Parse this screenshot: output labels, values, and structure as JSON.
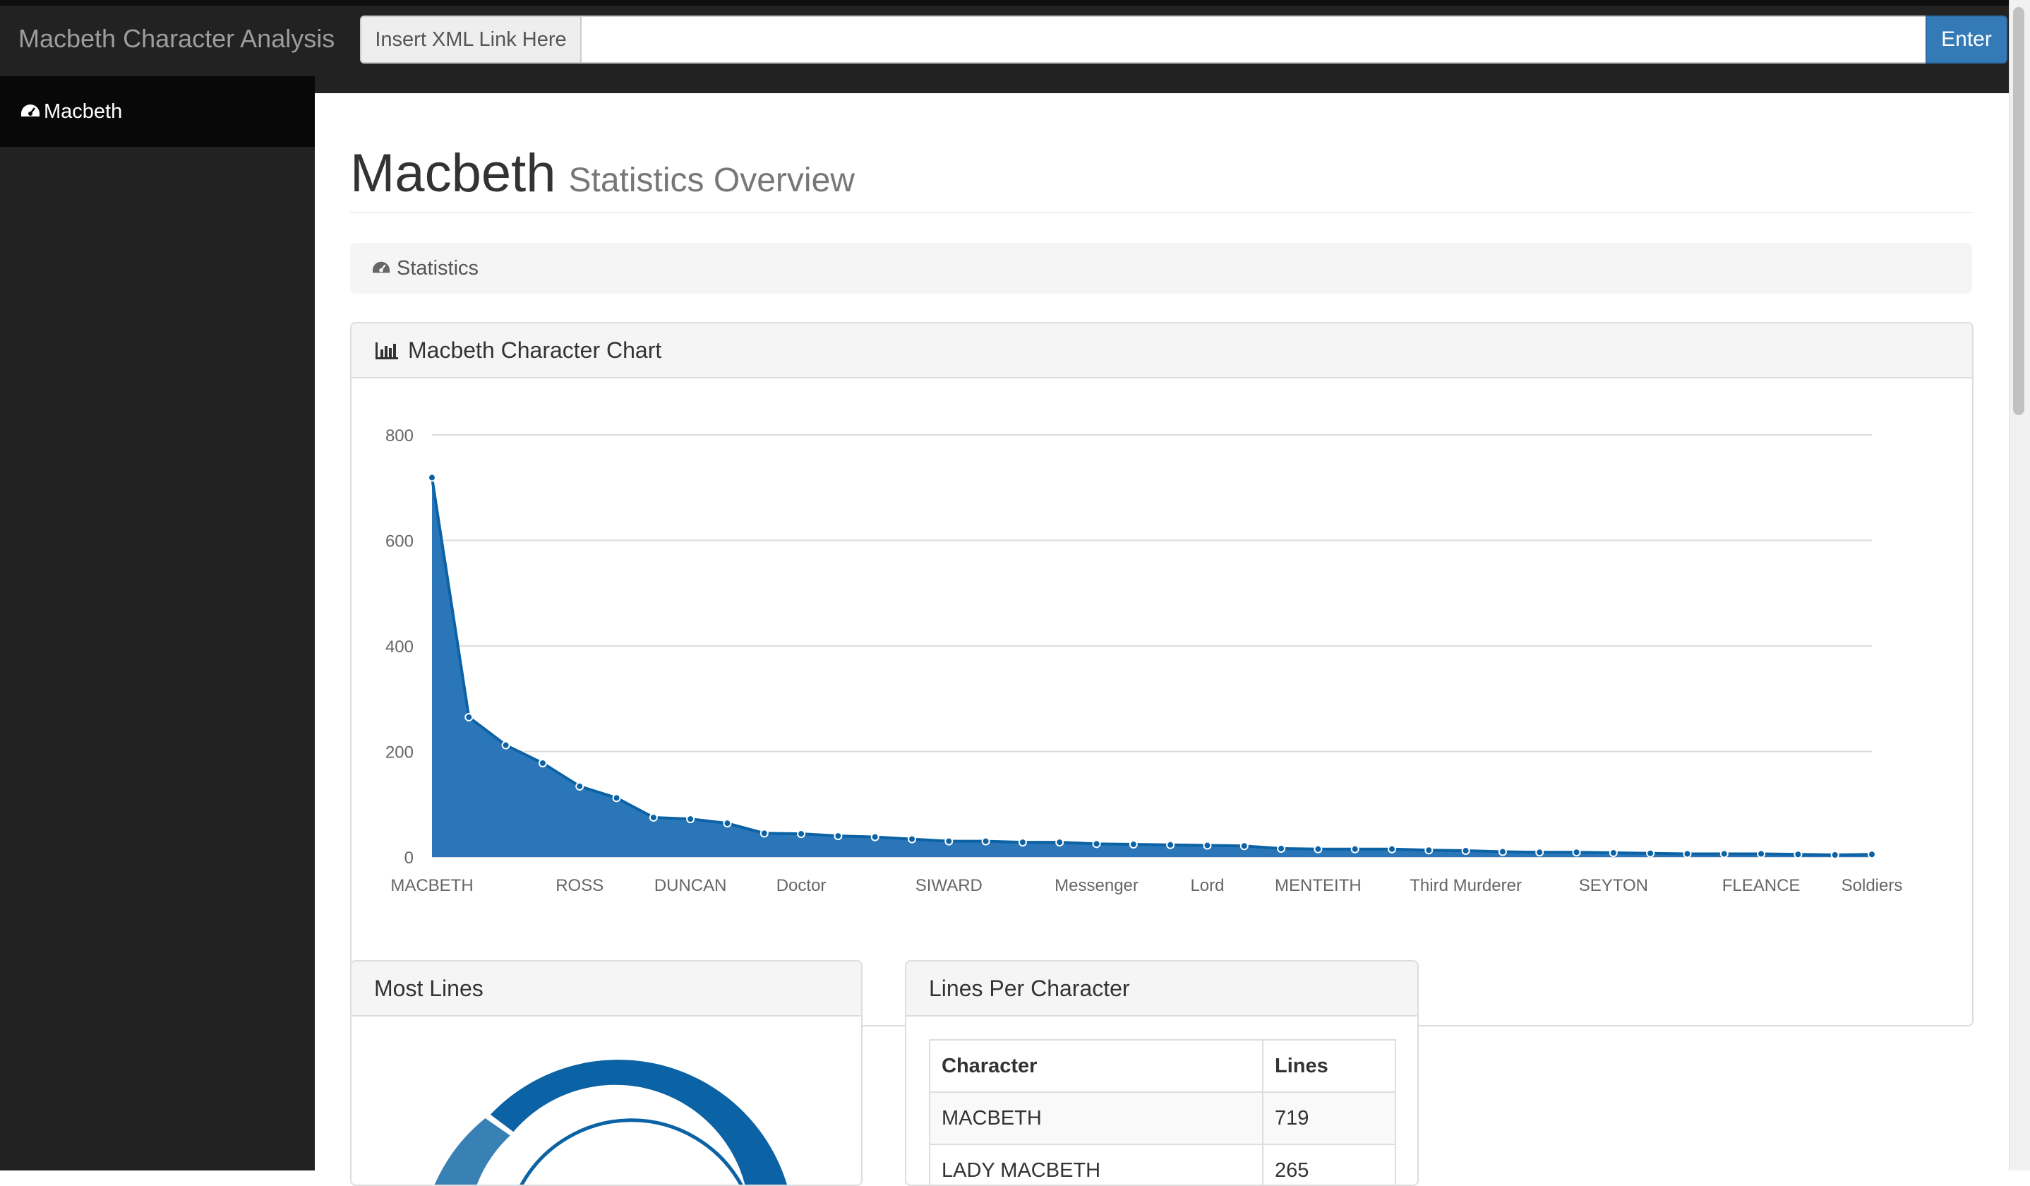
{
  "navbar": {
    "brand": "Macbeth Character Analysis",
    "xml_label": "Insert XML Link Here",
    "xml_value": "",
    "enter_label": "Enter"
  },
  "sidebar": {
    "items": [
      {
        "label": "Macbeth",
        "icon": "dashboard-icon"
      }
    ]
  },
  "header": {
    "title": "Macbeth",
    "subtitle": "Statistics Overview"
  },
  "breadcrumb": {
    "label": "Statistics",
    "icon": "dashboard-icon"
  },
  "chart_panel": {
    "title": "Macbeth Character Chart",
    "icon": "bar-chart-icon"
  },
  "chart_data": {
    "type": "area",
    "title": "",
    "xlabel": "",
    "ylabel": "",
    "ylim": [
      0,
      800
    ],
    "yticks": [
      0,
      200,
      400,
      600,
      800
    ],
    "grid": true,
    "color": "#1f6fb5",
    "x_tick_labels": [
      "MACBETH",
      "ROSS",
      "DUNCAN",
      "Doctor",
      "SIWARD",
      "Messenger",
      "Lord",
      "MENTEITH",
      "Third Murderer",
      "SEYTON",
      "FLEANCE",
      "Soldiers"
    ],
    "x_tick_positions": [
      0,
      4,
      7,
      10,
      14,
      18,
      21,
      24,
      28,
      32,
      36,
      39
    ],
    "values": [
      719,
      265,
      212,
      178,
      134,
      112,
      75,
      72,
      64,
      45,
      44,
      40,
      38,
      34,
      30,
      30,
      28,
      28,
      25,
      24,
      23,
      22,
      21,
      16,
      15,
      15,
      15,
      13,
      12,
      10,
      9,
      9,
      8,
      7,
      6,
      6,
      6,
      5,
      4,
      5
    ]
  },
  "most_lines_panel": {
    "title": "Most Lines"
  },
  "lines_per_character": {
    "title": "Lines Per Character",
    "columns": [
      "Character",
      "Lines"
    ],
    "rows": [
      [
        "MACBETH",
        "719"
      ],
      [
        "LADY MACBETH",
        "265"
      ]
    ]
  },
  "colors": {
    "navbar_bg": "#222222",
    "accent": "#337ab7",
    "chart_fill": "#1f6fb5",
    "donut_primary": "#0b62a4",
    "donut_secondary": "#3980b5"
  }
}
